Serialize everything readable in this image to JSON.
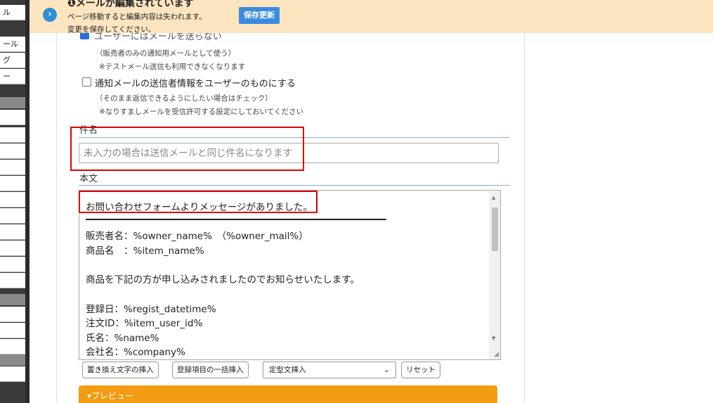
{
  "sidebar": {
    "items": [
      "ル",
      "ール",
      "グ",
      "ー",
      "",
      "",
      "",
      "",
      "",
      "",
      "",
      "",
      "",
      "",
      "",
      "",
      "",
      "",
      ""
    ]
  },
  "banner": {
    "title": "メールが編集されています",
    "line1": "ページ移動すると編集内容は失われます。",
    "line2": "変更を保存してください。",
    "save_button": "保存更新"
  },
  "options": {
    "hidden_checkbox_label": "ユーザーにはメールを送らない",
    "note1": "（販売者のみの通知用メールとして使う）",
    "note2": "※テストメール送信も利用できなくなります",
    "sender_checkbox_label": "通知メールの送信者情報をユーザーのものにする",
    "note3": "（そのまま返信できるようにしたい場合はチェック）",
    "note4": "※なりすましメールを受信許可する設定にしておいてください"
  },
  "subject": {
    "label": "件名",
    "placeholder": "未入力の場合は送信メールと同じ件名になります",
    "value": ""
  },
  "body": {
    "label": "本文",
    "lines": [
      "お問い合わせフォームよりメッセージがありました。",
      "販売者名：%owner_name%　（%owner_mail%）",
      "商品名　：%item_name%",
      "商品を下記の方が申し込みされましたのでお知らせいたします。",
      "登録日：%regist_datetime%",
      "注文ID：%item_user_id%",
      "氏名：%name%",
      "会社名：%company%"
    ]
  },
  "toolbar": {
    "insert_placeholder": "置き換え文字の挿入",
    "insert_all_fields": "登録項目の一括挿入",
    "template_select": "定型文挿入",
    "reset": "リセット"
  },
  "preview": {
    "label": "▾プレビュー"
  },
  "colors": {
    "banner_bg": "#fde5c0",
    "accent_blue": "#3b8be0",
    "preview_orange": "#f39c12",
    "highlight_red": "#e00000"
  }
}
